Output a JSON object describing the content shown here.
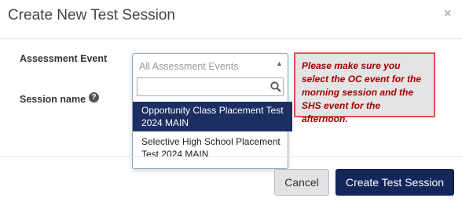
{
  "modal": {
    "title": "Create New Test Session",
    "close_icon": "×"
  },
  "form": {
    "assessment_event_label": "Assessment Event",
    "session_name_label": "Session name",
    "help_icon": "?"
  },
  "dropdown": {
    "selected_placeholder": "All Assessment Events",
    "search_value": "",
    "options": [
      {
        "label": "Opportunity Class Placement Test 2024 MAIN",
        "highlighted": true
      },
      {
        "label": "Selective High School Placement Test 2024 MAIN",
        "highlighted": false
      }
    ]
  },
  "notice": {
    "text": "Please make sure you select the OC event for the morning session and the SHS event for the afternoon."
  },
  "footer": {
    "cancel_label": "Cancel",
    "create_label": "Create Test Session"
  },
  "colors": {
    "primary": "#14275a",
    "highlight": "#1c2f63",
    "notice_text": "#a30000",
    "notice_border": "#d9534f"
  }
}
